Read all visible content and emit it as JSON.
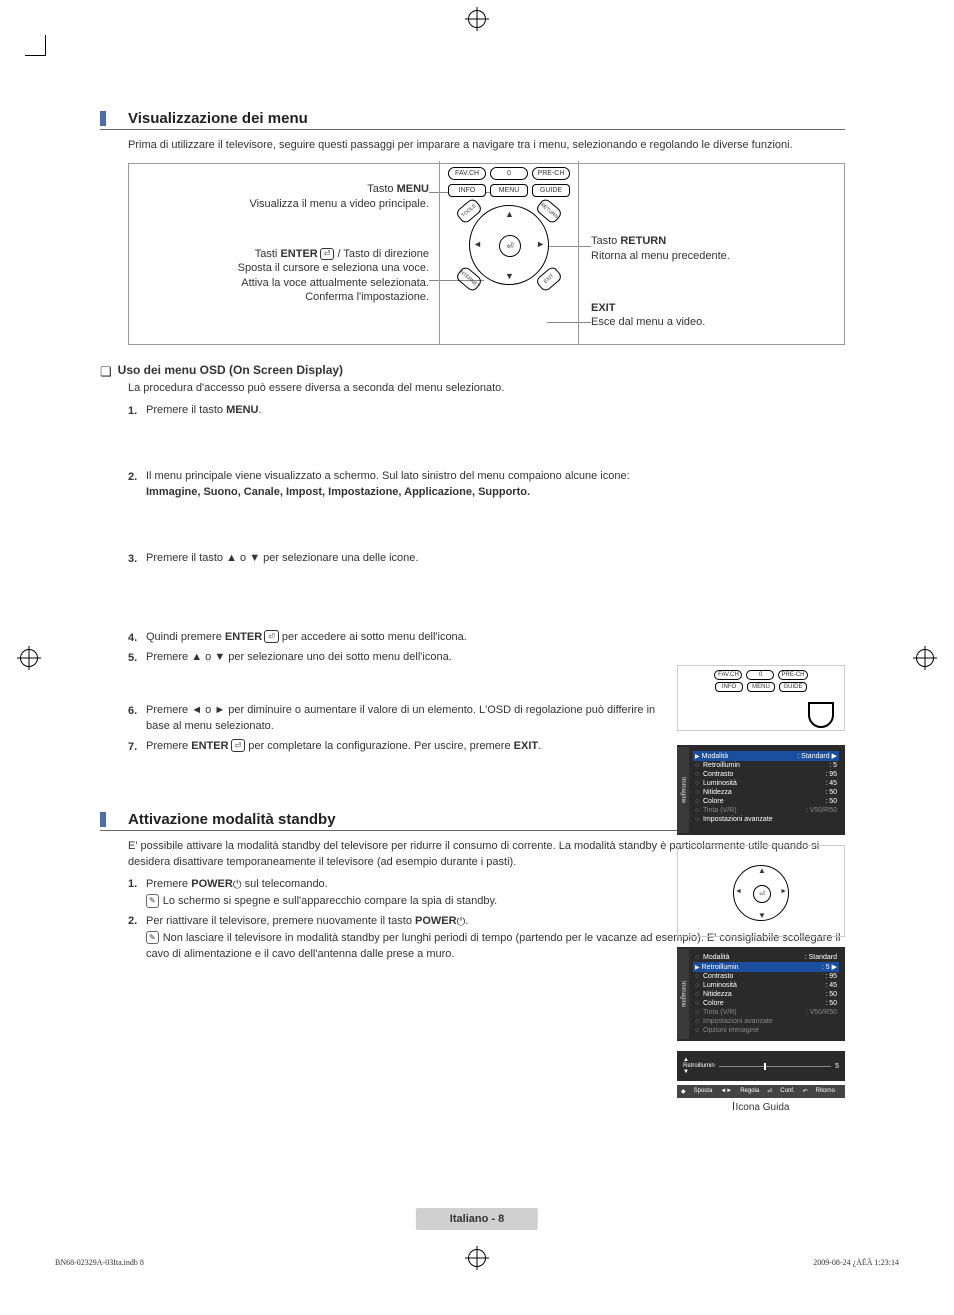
{
  "section1": {
    "title": "Visualizzazione dei menu",
    "intro": "Prima di utilizzare il televisore, seguire questi passaggi per imparare a navigare tra i menu, selezionando e regolando le diverse funzioni."
  },
  "remote": {
    "fav": "FAV.CH",
    "zero": "0",
    "prech": "PRE-CH",
    "info": "INFO",
    "menu": "MENU",
    "guide": "GUIDE",
    "tools": "TOOLS",
    "return": "RETURN",
    "internet": "INTERNET",
    "exit": "EXIT",
    "enter_glyph": "⏎"
  },
  "left_labels": {
    "b1a": "Tasto ",
    "b1a_bold": "MENU",
    "b1b": "Visualizza il menu a video principale.",
    "b2a": "Tasti ",
    "b2a_bold": "ENTER",
    "b2a_tail": " / Tasto di direzione",
    "b2b": "Sposta il cursore e seleziona una voce.",
    "b2c": "Attiva la voce attualmente selezionata.",
    "b2d": "Conferma l'impostazione."
  },
  "right_labels": {
    "b1a": "Tasto ",
    "b1a_bold": "RETURN",
    "b1b": "Ritorna al menu precedente.",
    "b2a_bold": "EXIT",
    "b2b": "Esce dal menu a video."
  },
  "osd_section": {
    "heading": "Uso dei menu OSD (On Screen Display)",
    "line1": "La procedura d'accesso può essere diversa a seconda del menu selezionato.",
    "step1_pre": "Premere il tasto ",
    "step1_bold": "MENU",
    "step1_post": ".",
    "step2_pre": "Il menu principale viene visualizzato a schermo. Sul lato sinistro del menu compaiono alcune icone: ",
    "step2_bold": "Immagine, Suono, Canale, Impost, Impostazione, Applicazione, Supporto.",
    "step3": "Premere il tasto ▲ o ▼ per selezionare una delle icone.",
    "step4_pre": "Quindi premere ",
    "step4_bold": "ENTER",
    "step4_post": " per accedere ai sotto menu dell'icona.",
    "step5": "Premere ▲ o ▼ per selezionare uno dei sotto menu dell'icona.",
    "step6": "Premere ◄ o ► per diminuire o aumentare il valore di un elemento. L'OSD di regolazione può differire in base al menu selezionato.",
    "step7_pre": "Premere ",
    "step7_bold1": "ENTER",
    "step7_mid": " per completare la configurazione. Per uscire, premere ",
    "step7_bold2": "EXIT",
    "step7_post": "."
  },
  "osd_panel1": {
    "side": "Immagine",
    "rows": [
      {
        "label": "Modalità",
        "value": ": Standard",
        "sel": true
      },
      {
        "label": "Retroillumin",
        "value": ": 5"
      },
      {
        "label": "Contrasto",
        "value": ": 95"
      },
      {
        "label": "Luminosità",
        "value": ": 45"
      },
      {
        "label": "Nitidezza",
        "value": ": 50"
      },
      {
        "label": "Colore",
        "value": ": 50"
      },
      {
        "label": "Tinta (V/R)",
        "value": ": V50/R50",
        "dim": true
      },
      {
        "label": "Impostazioni avanzate",
        "value": ""
      }
    ]
  },
  "osd_panel2": {
    "side": "Immagine",
    "rows": [
      {
        "label": "Modalità",
        "value": ": Standard"
      },
      {
        "label": "Retroillumin",
        "value": ": 5",
        "sel": true
      },
      {
        "label": "Contrasto",
        "value": ": 95"
      },
      {
        "label": "Luminosità",
        "value": ": 45"
      },
      {
        "label": "Nitidezza",
        "value": ": 50"
      },
      {
        "label": "Colore",
        "value": ": 50"
      },
      {
        "label": "Tinta (V/R)",
        "value": ": V50/R50",
        "dim": true
      },
      {
        "label": "Impostazioni avanzate",
        "value": "",
        "dim": true
      },
      {
        "label": "Opzioni immagine",
        "value": "",
        "dim": true
      }
    ]
  },
  "slider": {
    "label": "Retroillumin",
    "value": "5",
    "arrows_up": "▲",
    "arrows_down": "▼"
  },
  "helpbar": {
    "move": "Sposta",
    "adjust": "Regola",
    "conf": "Conf.",
    "return": "Ritorno"
  },
  "help_label": "Icona Guida",
  "section2": {
    "title": "Attivazione modalità standby",
    "intro": "E' possibile attivare la modalità standby del televisore per ridurre il consumo di corrente. La modalità standby è particolarmente utile quando si desidera disattivare temporaneamente il televisore (ad esempio durante i pasti).",
    "s1_pre": "Premere  ",
    "s1_bold": "POWER",
    "s1_post": " sul telecomando.",
    "s1_note": "Lo schermo si spegne e sull'apparecchio compare la spia di standby.",
    "s2_pre": "Per riattivare il televisore, premere nuovamente il tasto ",
    "s2_bold": "POWER",
    "s2_post": ".",
    "s2_note": "Non lasciare il televisore in modalità standby per lunghi periodi di tempo (partendo per le vacanze ad esempio). E' consigliabile scollegare il cavo di alimentazione e il cavo dell'antenna dalle prese a muro."
  },
  "page_num": "Italiano - 8",
  "footer_left": "BN68-02329A-03Ita.indb   8",
  "footer_right": "2009-08-24   ¿ÀÈÄ 1:23:14"
}
